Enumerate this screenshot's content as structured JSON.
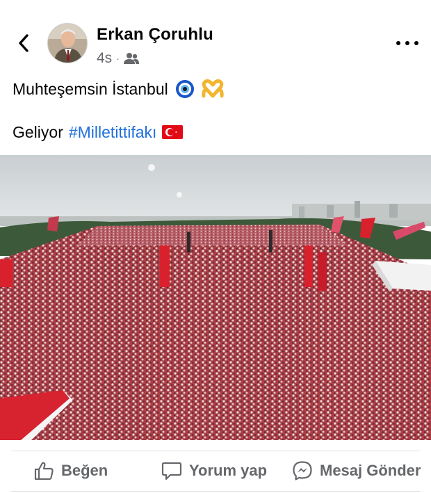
{
  "post": {
    "author": "Erkan Çoruhlu",
    "timestamp": "4s",
    "separator": "·",
    "audience_icon": "friends-icon",
    "text_line1": "Muhteşemsin İstanbul",
    "text_line2_prefix": "Geliyor",
    "hashtag": "#Milletittifakı"
  },
  "actions": {
    "like_label": "Beğen",
    "comment_label": "Yorum yap",
    "message_label": "Mesaj Gönder"
  },
  "colors": {
    "text": "#050505",
    "secondary": "#65676b",
    "link": "#216fdb",
    "divider": "#dadde1"
  }
}
